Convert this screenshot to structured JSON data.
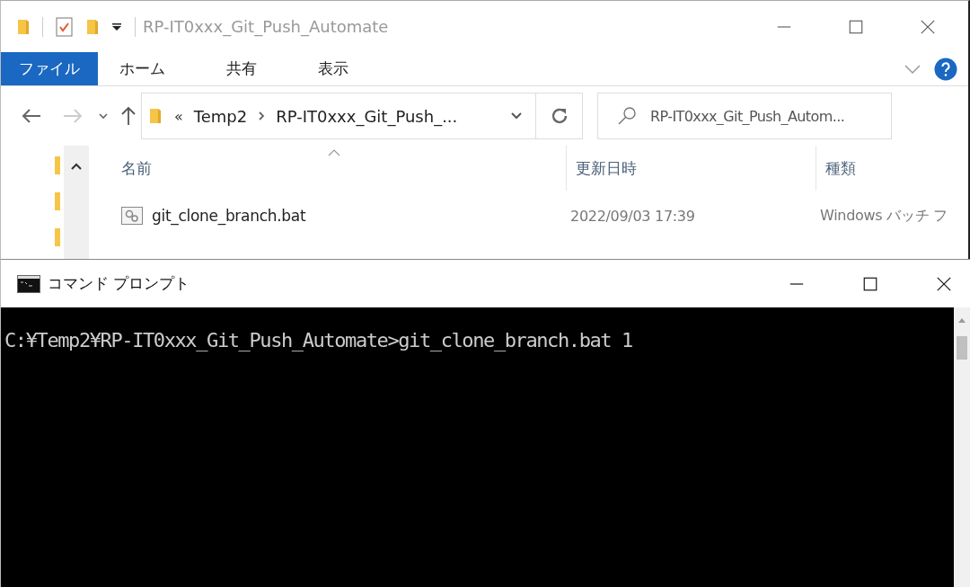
{
  "explorer": {
    "title": "RP-IT0xxx_Git_Push_Automate",
    "ribbon_tabs": [
      {
        "label": "ファイル",
        "selected": true
      },
      {
        "label": "ホーム",
        "selected": false
      },
      {
        "label": "共有",
        "selected": false
      },
      {
        "label": "表示",
        "selected": false
      }
    ],
    "address": {
      "overflow": "«",
      "crumbs": [
        "Temp2",
        "RP-IT0xxx_Git_Push_..."
      ]
    },
    "search": {
      "placeholder": "RP-IT0xxx_Git_Push_Autom..."
    },
    "columns": [
      "名前",
      "更新日時",
      "種類"
    ],
    "rows": [
      {
        "name": "git_clone_branch.bat",
        "modified": "2022/09/03 17:39",
        "type": "Windows バッチ フ"
      }
    ]
  },
  "cmd": {
    "title": "コマンド プロンプト",
    "lines": [
      "C:¥Temp2¥RP-IT0xxx_Git_Push_Automate>git_clone_branch.bat 1"
    ]
  }
}
